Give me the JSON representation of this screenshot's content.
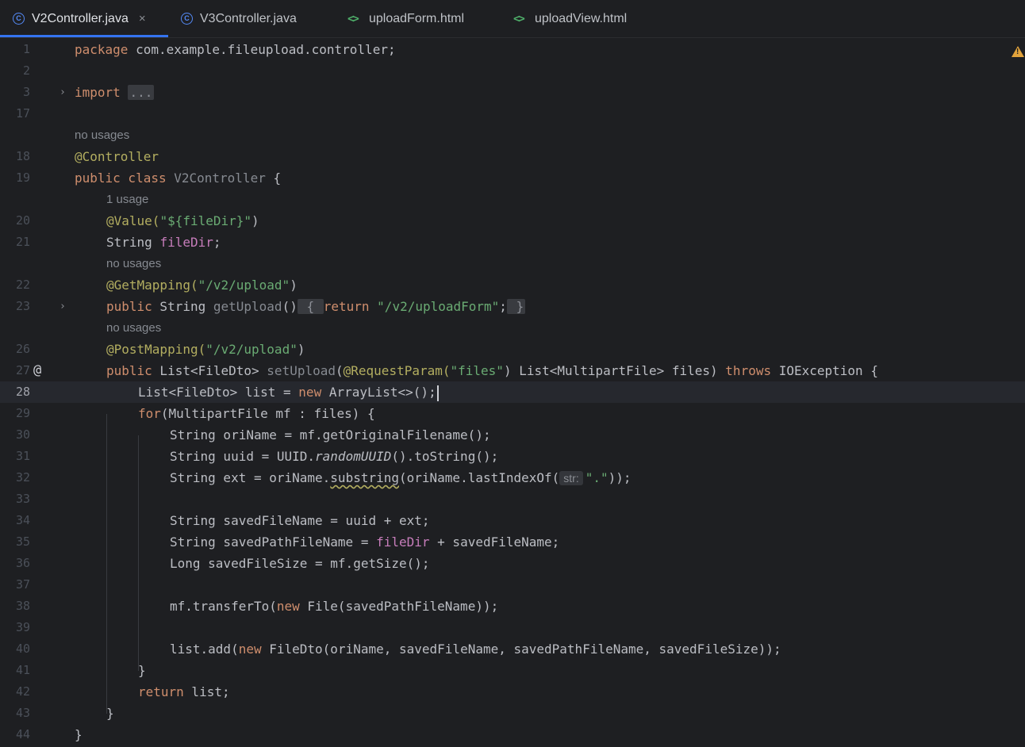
{
  "tabs": [
    {
      "label": "V2Controller.java",
      "icon": "java-class-icon",
      "close": "×"
    },
    {
      "label": "V3Controller.java",
      "icon": "java-class-icon"
    },
    {
      "label": "uploadForm.html",
      "icon": "html-file-icon"
    },
    {
      "label": "uploadView.html",
      "icon": "html-file-icon"
    }
  ],
  "icons": {
    "class_glyph": "C",
    "html_glyph": "<>",
    "fold_glyph": "›",
    "implements_glyph": "@",
    "warning_glyph": "!"
  },
  "colors": {
    "keyword": "#cf8e6d",
    "annotation": "#b3ae60",
    "string": "#6aab73",
    "field": "#c77dbb",
    "text": "#bcbec4",
    "accent": "#3574f0",
    "warning": "#e2a33c"
  },
  "editor": {
    "current_line": "28",
    "lines": [
      {
        "n": "1",
        "t": {
          "a": "package",
          "b": " com.example.fileupload.controller;"
        }
      },
      {
        "n": "2"
      },
      {
        "n": "3",
        "t": {
          "a": "import",
          "b": " ",
          "c": "..."
        }
      },
      {
        "n": "17"
      },
      {
        "usage": "no usages"
      },
      {
        "n": "18",
        "t": {
          "a": "@Controller"
        }
      },
      {
        "n": "19",
        "t": {
          "a": "public class",
          "b": " ",
          "c": "V2Controller",
          "d": " {"
        }
      },
      {
        "usage": "1 usage"
      },
      {
        "n": "20",
        "t": {
          "a": "@Value(",
          "b": "\"${fileDir}\"",
          "c": ")"
        }
      },
      {
        "n": "21",
        "t": {
          "a": "String ",
          "b": "fileDir",
          "c": ";"
        }
      },
      {
        "usage": "no usages"
      },
      {
        "n": "22",
        "t": {
          "a": "@GetMapping(",
          "b": "\"/v2/upload\"",
          "c": ")"
        }
      },
      {
        "n": "23",
        "t": {
          "a": "public",
          "b": " String ",
          "c": "getUpload",
          "d": "()",
          "e": " { ",
          "f": "return",
          "g": " ",
          "h": "\"/v2/uploadForm\"",
          "i": ";",
          "j": " }"
        }
      },
      {
        "usage": "no usages"
      },
      {
        "n": "26",
        "t": {
          "a": "@PostMapping(",
          "b": "\"/v2/upload\"",
          "c": ")"
        }
      },
      {
        "n": "27",
        "t": {
          "a": "public",
          "b": " List<FileDto> ",
          "c": "setUpload",
          "d": "(",
          "e": "@RequestParam(",
          "f": "\"files\"",
          "g": ")",
          "h": " List<MultipartFile> files) ",
          "i": "throws",
          "j": " IOException {"
        }
      },
      {
        "n": "28",
        "t": {
          "a": "List<FileDto> list = ",
          "b": "new",
          "c": " ArrayList<>();"
        }
      },
      {
        "n": "29",
        "t": {
          "a": "for",
          "b": "(MultipartFile mf : files) {"
        }
      },
      {
        "n": "30",
        "t": {
          "a": "String oriName = mf.getOriginalFilename();"
        }
      },
      {
        "n": "31",
        "t": {
          "a": "String uuid = UUID.",
          "b": "randomUUID",
          "c": "().toString();"
        }
      },
      {
        "n": "32",
        "t": {
          "a": "String ext = oriName.",
          "b": "substring",
          "c": "(oriName.lastIndexOf(",
          "d": "str:",
          "e": "\".\"",
          "f": "));"
        }
      },
      {
        "n": "33"
      },
      {
        "n": "34",
        "t": {
          "a": "String savedFileName = uuid + ext;"
        }
      },
      {
        "n": "35",
        "t": {
          "a": "String savedPathFileName = ",
          "b": "fileDir",
          "c": " + savedFileName;"
        }
      },
      {
        "n": "36",
        "t": {
          "a": "Long savedFileSize = mf.getSize();"
        }
      },
      {
        "n": "37"
      },
      {
        "n": "38",
        "t": {
          "a": "mf.transferTo(",
          "b": "new",
          "c": " File(savedPathFileName));"
        }
      },
      {
        "n": "39"
      },
      {
        "n": "40",
        "t": {
          "a": "list.add(",
          "b": "new",
          "c": " FileDto(oriName, savedFileName, savedPathFileName, savedFileSize));"
        }
      },
      {
        "n": "41",
        "t": {
          "a": "}"
        }
      },
      {
        "n": "42",
        "t": {
          "a": "return",
          "b": " list;"
        }
      },
      {
        "n": "43",
        "t": {
          "a": "}"
        }
      },
      {
        "n": "44",
        "t": {
          "a": "}"
        }
      }
    ]
  }
}
